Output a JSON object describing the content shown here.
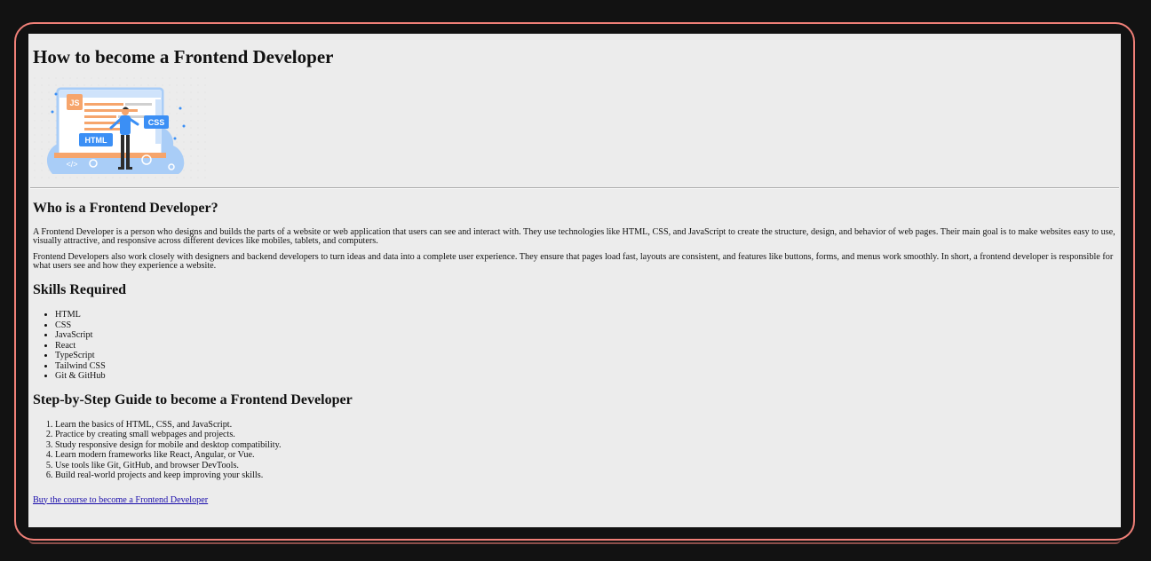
{
  "title": "How to become a Frontend Developer",
  "illustration": {
    "labels": {
      "js": "JS",
      "css": "CSS",
      "html": "HTML",
      "code": "</>"
    },
    "colors": {
      "accent": "#3b8ff5",
      "orange": "#f6a56c",
      "light_blue": "#a9cdf7"
    }
  },
  "section1": {
    "heading": "Who is a Frontend Developer?",
    "p1": "A Frontend Developer is a person who designs and builds the parts of a website or web application that users can see and interact with. They use technologies like HTML, CSS, and JavaScript to create the structure, design, and behavior of web pages. Their main goal is to make websites easy to use, visually attractive, and responsive across different devices like mobiles, tablets, and computers.",
    "p2": "Frontend Developers also work closely with designers and backend developers to turn ideas and data into a complete user experience. They ensure that pages load fast, layouts are consistent, and features like buttons, forms, and menus work smoothly. In short, a frontend developer is responsible for what users see and how they experience a website."
  },
  "skills": {
    "heading": "Skills Required",
    "items": [
      "HTML",
      "CSS",
      "JavaScript",
      "React",
      "TypeScript",
      "Tailwind CSS",
      "Git & GitHub"
    ]
  },
  "guide": {
    "heading": "Step-by-Step Guide to become a Frontend Developer",
    "steps": [
      "Learn the basics of HTML, CSS, and JavaScript.",
      "Practice by creating small webpages and projects.",
      "Study responsive design for mobile and desktop compatibility.",
      "Learn modern frameworks like React, Angular, or Vue.",
      "Use tools like Git, GitHub, and browser DevTools.",
      "Build real-world projects and keep improving your skills."
    ]
  },
  "link": {
    "label": "Buy the course to become a Frontend Developer"
  }
}
